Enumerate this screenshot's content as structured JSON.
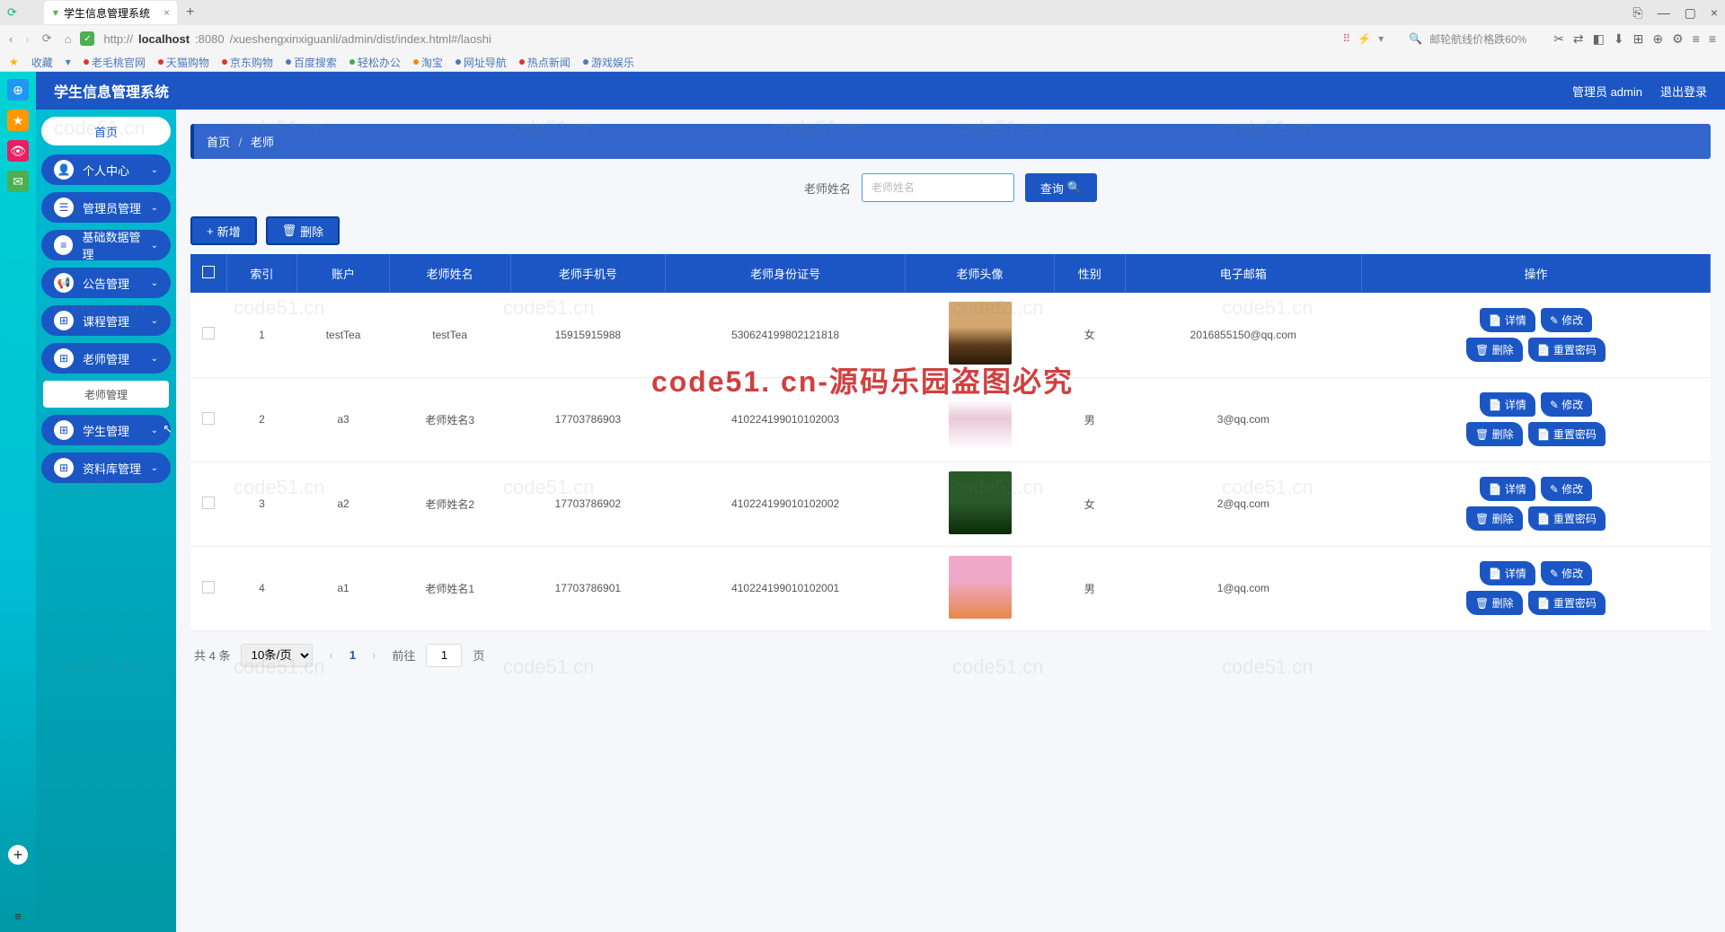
{
  "browser": {
    "tab_title": "学生信息管理系统",
    "url_host": "localhost",
    "url_prefix": "http://",
    "url_port": ":8080",
    "url_path": "/xueshengxinxiguanli/admin/dist/index.html#/laoshi",
    "search_placeholder": "邮轮航线价格跌60%",
    "bookmarks_label": "收藏",
    "bookmarks": [
      "老毛桃官网",
      "天猫购物",
      "京东购物",
      "百度搜索",
      "轻松办公",
      "淘宝",
      "网址导航",
      "热点新闻",
      "游戏娱乐"
    ]
  },
  "header": {
    "app_title": "学生信息管理系统",
    "user_label": "管理员 admin",
    "logout": "退出登录"
  },
  "sidebar": {
    "home": "首页",
    "items": [
      {
        "icon": "👤",
        "label": "个人中心"
      },
      {
        "icon": "☰",
        "label": "管理员管理"
      },
      {
        "icon": "▤",
        "label": "基础数据管理"
      },
      {
        "icon": "📢",
        "label": "公告管理"
      },
      {
        "icon": "⊞",
        "label": "课程管理"
      },
      {
        "icon": "⊞",
        "label": "老师管理"
      },
      {
        "icon": "⊞",
        "label": "学生管理"
      },
      {
        "icon": "⊞",
        "label": "资料库管理"
      }
    ],
    "submenu_active": "老师管理"
  },
  "breadcrumb": {
    "home": "首页",
    "current": "老师"
  },
  "search": {
    "label": "老师姓名",
    "placeholder": "老师姓名",
    "query_btn": "查询"
  },
  "actions": {
    "add": "新增",
    "delete": "删除"
  },
  "table": {
    "headers": [
      "",
      "索引",
      "账户",
      "老师姓名",
      "老师手机号",
      "老师身份证号",
      "老师头像",
      "性别",
      "电子邮箱",
      "操作"
    ],
    "ops": {
      "detail": "详情",
      "edit": "修改",
      "delete": "删除",
      "reset": "重置密码"
    },
    "rows": [
      {
        "idx": "1",
        "account": "testTea",
        "name": "testTea",
        "phone": "15915915988",
        "idcard": "530624199802121818",
        "avatar": "av1",
        "gender": "女",
        "email": "2016855150@qq.com"
      },
      {
        "idx": "2",
        "account": "a3",
        "name": "老师姓名3",
        "phone": "17703786903",
        "idcard": "410224199010102003",
        "avatar": "av2",
        "gender": "男",
        "email": "3@qq.com"
      },
      {
        "idx": "3",
        "account": "a2",
        "name": "老师姓名2",
        "phone": "17703786902",
        "idcard": "410224199010102002",
        "avatar": "av3",
        "gender": "女",
        "email": "2@qq.com"
      },
      {
        "idx": "4",
        "account": "a1",
        "name": "老师姓名1",
        "phone": "17703786901",
        "idcard": "410224199010102001",
        "avatar": "av4",
        "gender": "男",
        "email": "1@qq.com"
      }
    ]
  },
  "pager": {
    "total": "共 4 条",
    "per_page": "10条/页",
    "current": "1",
    "goto": "前往",
    "page_suffix": "页",
    "goto_val": "1"
  },
  "watermark": "code51. cn-源码乐园盗图必究",
  "wm_small": "code51.cn"
}
